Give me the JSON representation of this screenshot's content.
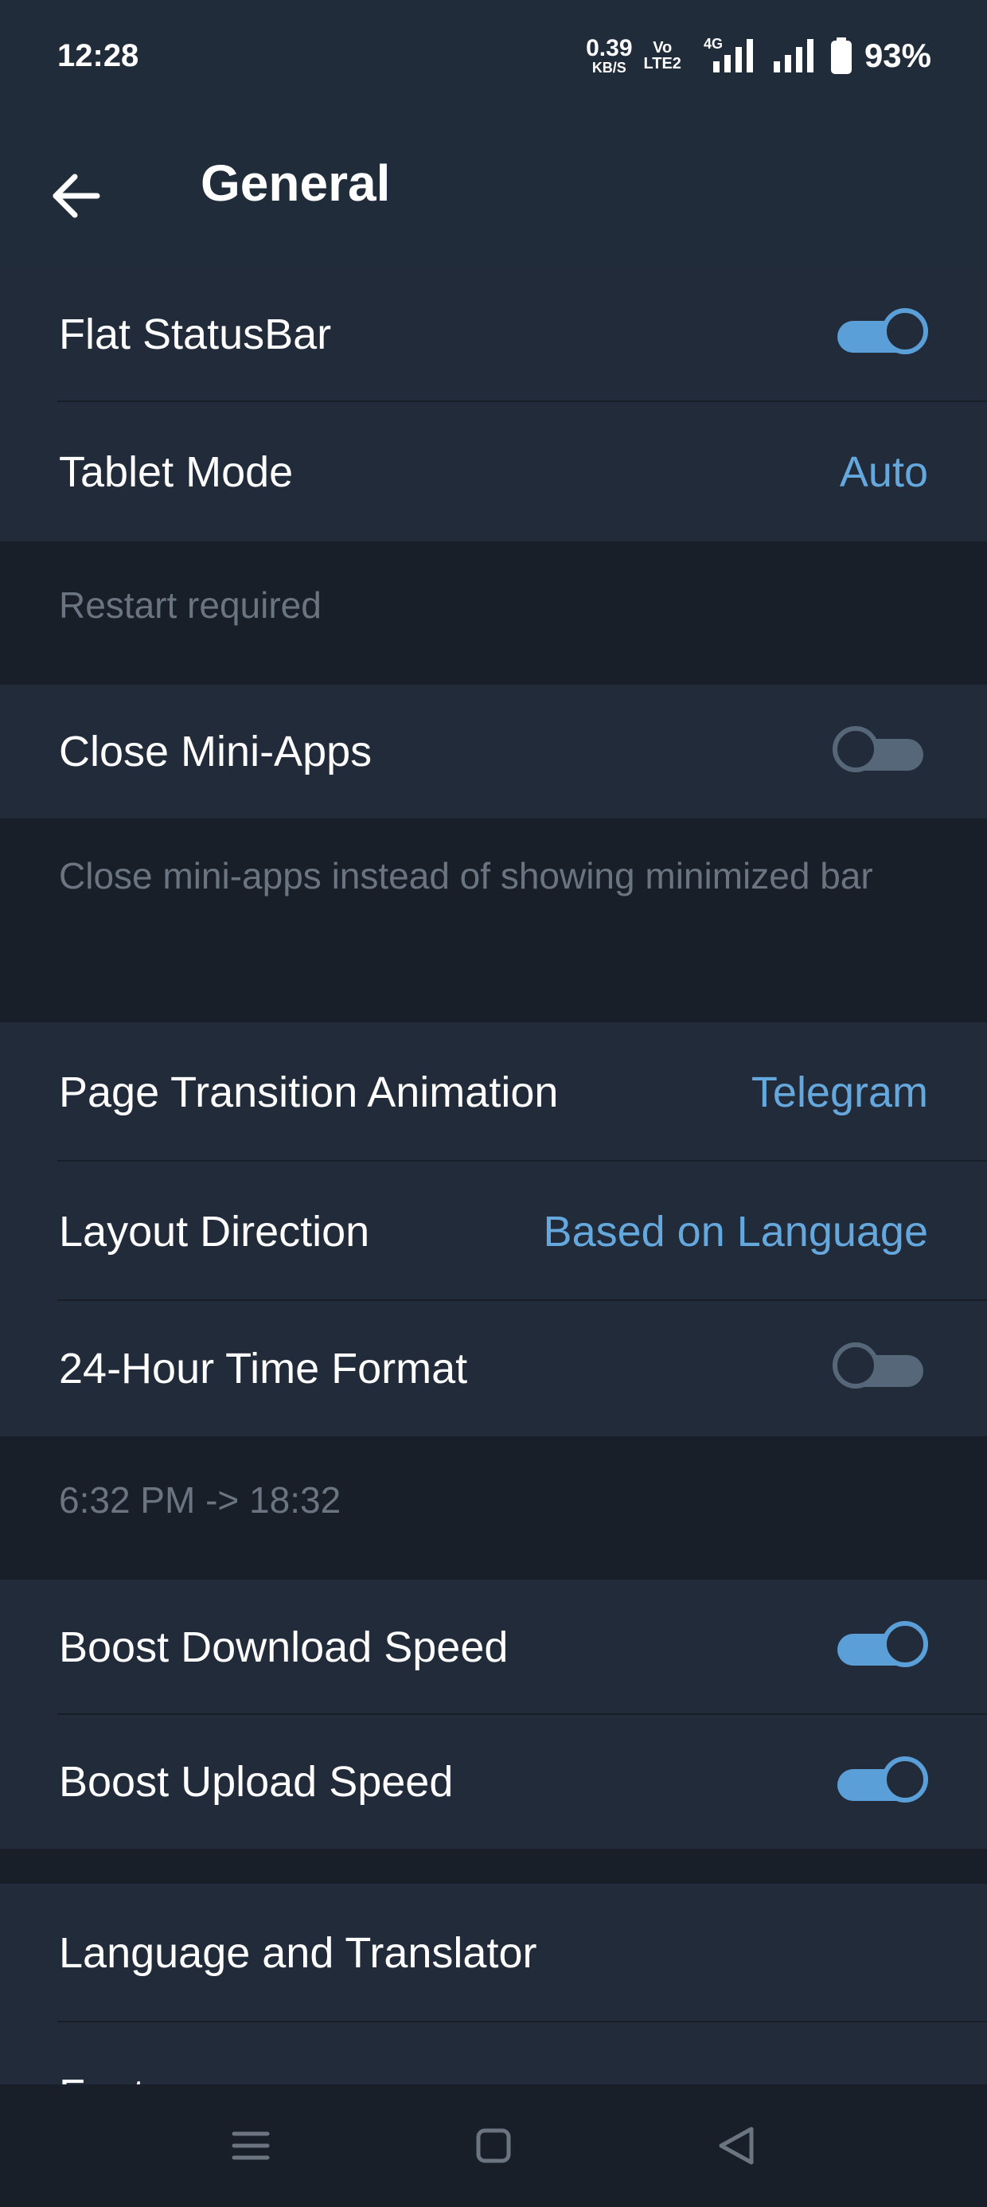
{
  "status_bar": {
    "time": "12:28",
    "net_speed_value": "0.39",
    "net_speed_unit": "KB/S",
    "volte_top": "Vo",
    "volte_bottom": "LTE2",
    "network": "4G",
    "battery": "93%"
  },
  "header": {
    "title": "General",
    "back_icon": "arrow-left-icon"
  },
  "settings": {
    "flat_statusbar": {
      "label": "Flat StatusBar",
      "enabled": true
    },
    "tablet_mode": {
      "label": "Tablet Mode",
      "value": "Auto"
    },
    "tablet_mode_info": "Restart required",
    "close_mini_apps": {
      "label": "Close Mini-Apps",
      "enabled": false
    },
    "close_mini_apps_info": "Close mini-apps instead of showing minimized bar",
    "page_transition": {
      "label": "Page Transition Animation",
      "value": "Telegram"
    },
    "layout_direction": {
      "label": "Layout Direction",
      "value": "Based on Language"
    },
    "time_format": {
      "label": "24-Hour Time Format",
      "enabled": false
    },
    "time_format_info": "6:32 PM -> 18:32",
    "boost_download": {
      "label": "Boost Download Speed",
      "enabled": true
    },
    "boost_upload": {
      "label": "Boost Upload Speed",
      "enabled": true
    },
    "language_translator": {
      "label": "Language and Translator"
    },
    "fonts": {
      "label": "Fonts"
    }
  },
  "nav_bar": {
    "menu_icon": "menu-icon",
    "home_icon": "home-square-icon",
    "back_icon": "back-triangle-icon"
  },
  "colors": {
    "accent": "#65a8de",
    "background": "#1c2430",
    "row_background": "#212b39",
    "info_background": "#181f29",
    "secondary_text": "#6b7581"
  }
}
